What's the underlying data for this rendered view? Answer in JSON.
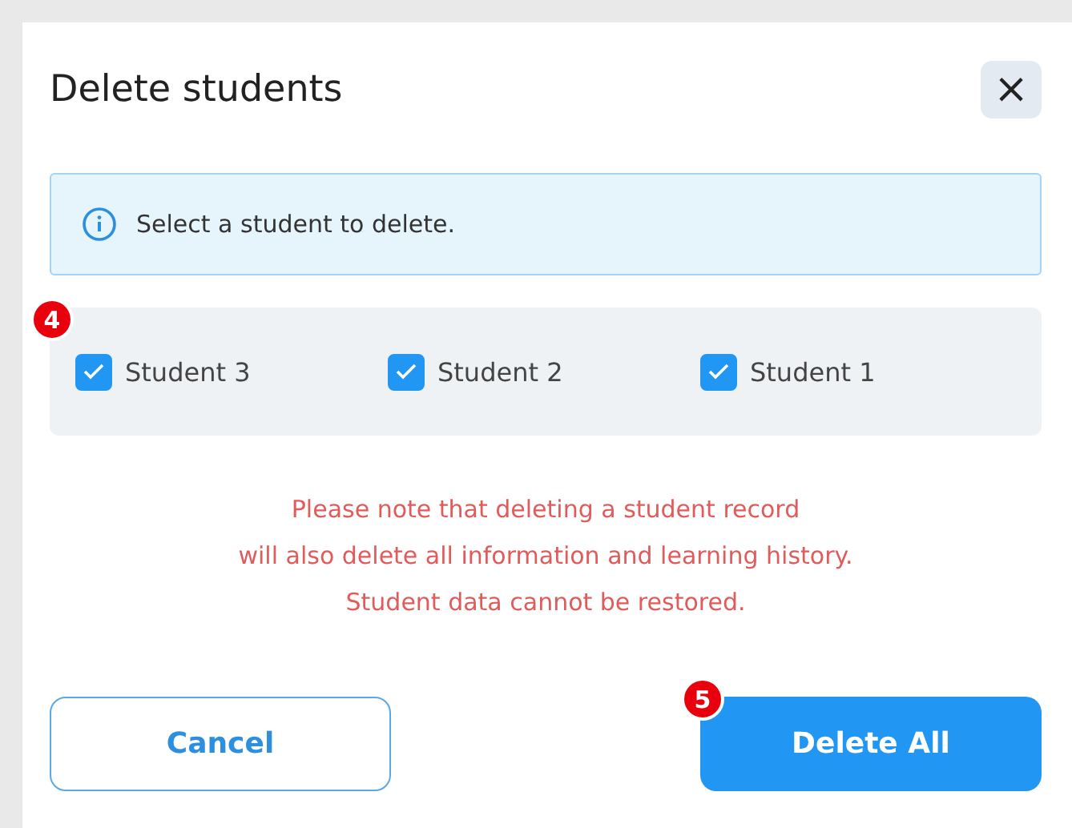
{
  "dialog": {
    "title": "Delete students",
    "close": "×"
  },
  "info": {
    "text": "Select a student to delete."
  },
  "students": [
    {
      "label": "Student 3",
      "checked": true
    },
    {
      "label": "Student 2",
      "checked": true
    },
    {
      "label": "Student 1",
      "checked": true
    }
  ],
  "warning": [
    "Please note that deleting a student record",
    "will also delete all information and learning history.",
    "Student data cannot be restored."
  ],
  "buttons": [
    {
      "kind": "secondary",
      "label": "Cancel"
    },
    {
      "kind": "primary",
      "label": "Delete All"
    }
  ],
  "markers": [
    "4",
    "5"
  ]
}
